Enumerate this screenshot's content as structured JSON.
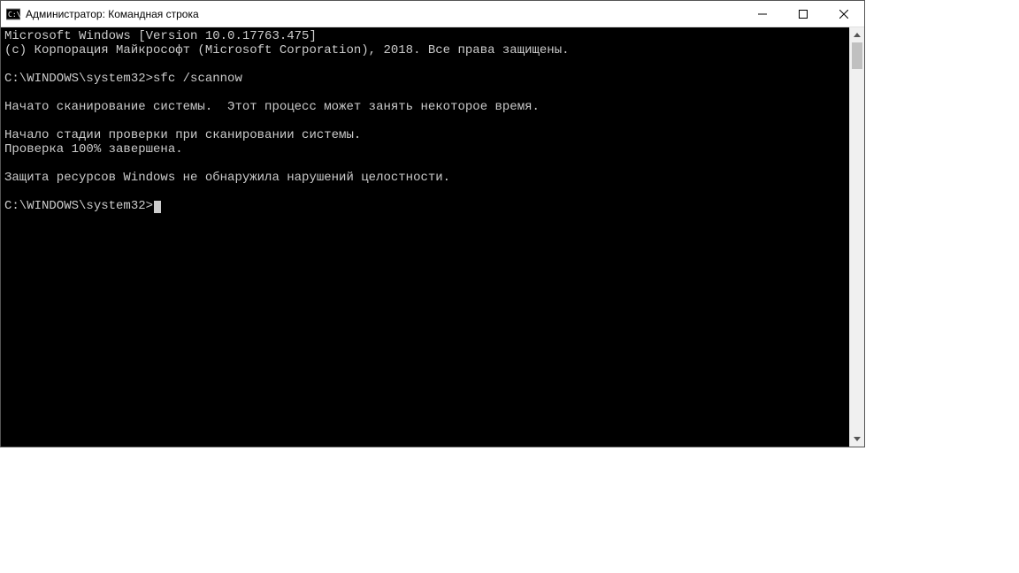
{
  "titlebar": {
    "title": "Администратор: Командная строка"
  },
  "terminal": {
    "line1": "Microsoft Windows [Version 10.0.17763.475]",
    "line2": "(c) Корпорация Майкрософт (Microsoft Corporation), 2018. Все права защищены.",
    "prompt1_path": "C:\\WINDOWS\\system32>",
    "prompt1_cmd": "sfc /scannow",
    "msg_scan_started": "Начато сканирование системы.  Этот процесс может занять некоторое время.",
    "msg_stage_begin": "Начало стадии проверки при сканировании системы.",
    "msg_progress": "Проверка 100% завершена.",
    "msg_result": "Защита ресурсов Windows не обнаружила нарушений целостности.",
    "prompt2_path": "C:\\WINDOWS\\system32>"
  }
}
